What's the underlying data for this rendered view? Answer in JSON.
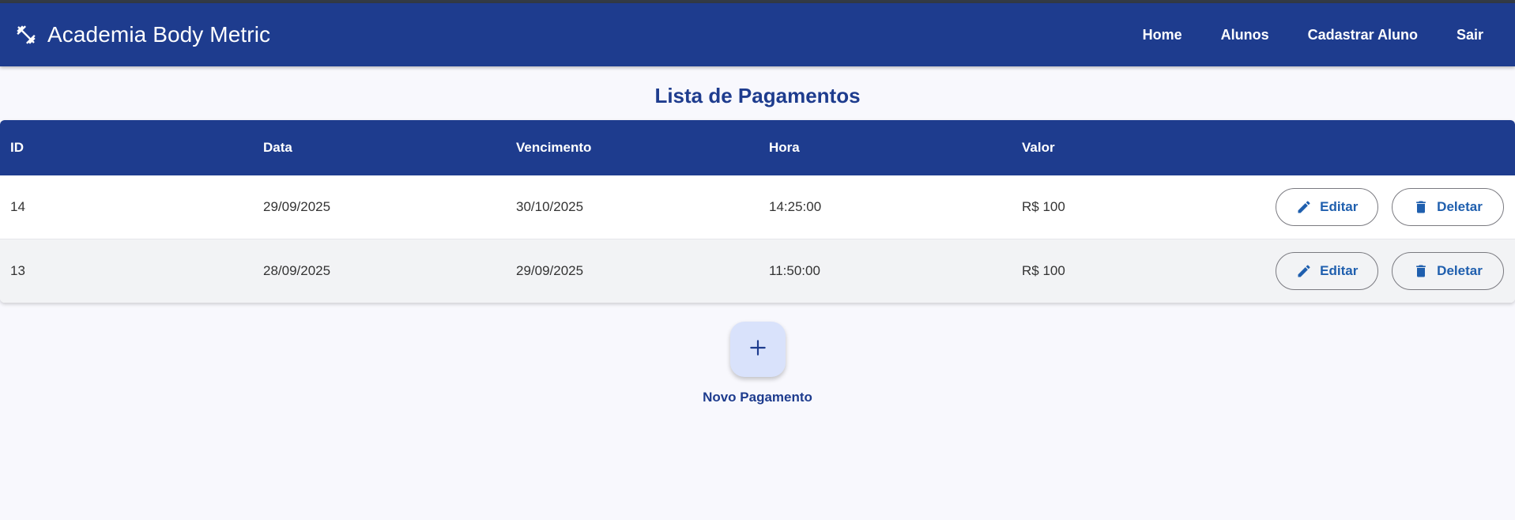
{
  "app": {
    "title": "Academia Body Metric",
    "logo_icon": "dumbbell-icon"
  },
  "nav": {
    "items": [
      {
        "label": "Home"
      },
      {
        "label": "Alunos"
      },
      {
        "label": "Cadastrar Aluno"
      },
      {
        "label": "Sair"
      }
    ]
  },
  "page": {
    "title": "Lista de Pagamentos"
  },
  "table": {
    "columns": [
      "ID",
      "Data",
      "Vencimento",
      "Hora",
      "Valor"
    ],
    "rows": [
      {
        "id": "14",
        "data": "29/09/2025",
        "vencimento": "30/10/2025",
        "hora": "14:25:00",
        "valor": "R$ 100"
      },
      {
        "id": "13",
        "data": "28/09/2025",
        "vencimento": "29/09/2025",
        "hora": "11:50:00",
        "valor": "R$ 100"
      }
    ],
    "actions": {
      "edit_label": "Editar",
      "edit_icon": "pencil-icon",
      "delete_label": "Deletar",
      "delete_icon": "trash-icon"
    }
  },
  "fab": {
    "icon": "plus-icon",
    "label": "Novo Pagamento"
  },
  "colors": {
    "primary": "#1e3c8e",
    "action_text": "#1f5fae",
    "fab_bg": "#d9e2fb",
    "page_bg": "#f8f8fd"
  }
}
